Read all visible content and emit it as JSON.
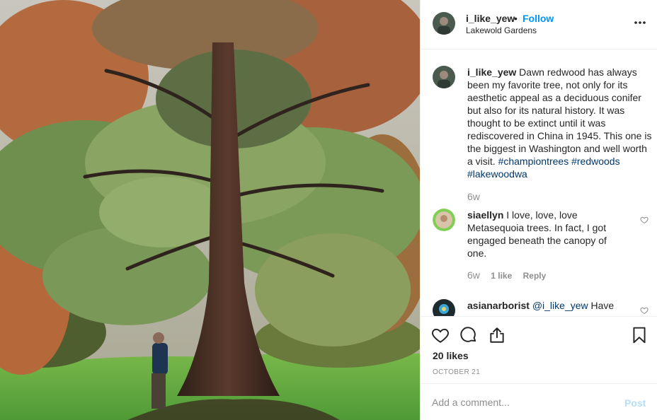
{
  "post": {
    "image_description": "",
    "author": "i_like_yew",
    "separator": "•",
    "follow_label": "Follow",
    "location": "Lakewold Gardens",
    "more_icon": "more-horizontal-icon"
  },
  "caption": {
    "username": "i_like_yew",
    "text": "Dawn redwood has always been my favorite tree, not only for its aesthetic appeal as a deciduous conifer but also for its natural history. It was thought to be extinct until it was rediscovered in China in 1945. This one is the biggest in Washington and well worth a visit.",
    "hashtags": [
      "#championtrees",
      "#redwoods",
      "#lakewoodwa"
    ],
    "age": "6w"
  },
  "comments": [
    {
      "username": "siaellyn",
      "text": "I love, love, love Metasequoia trees. In fact, I got engaged beneath the canopy of one.",
      "age": "6w",
      "likes": "1 like",
      "reply_label": "Reply"
    },
    {
      "username": "asianarborist",
      "mention": "@i_like_yew",
      "text": "Have"
    }
  ],
  "actions": {
    "like_icon": "heart-icon",
    "comment_icon": "comment-icon",
    "share_icon": "share-icon",
    "save_icon": "bookmark-icon",
    "likes": "20 likes",
    "date": "OCTOBER 21"
  },
  "add_comment": {
    "placeholder": "Add a comment...",
    "post_label": "Post"
  },
  "colors": {
    "link_blue": "#0095f6",
    "hashtag": "#00376b",
    "muted": "#8e8e8e",
    "post_disabled": "#b2dffc"
  }
}
